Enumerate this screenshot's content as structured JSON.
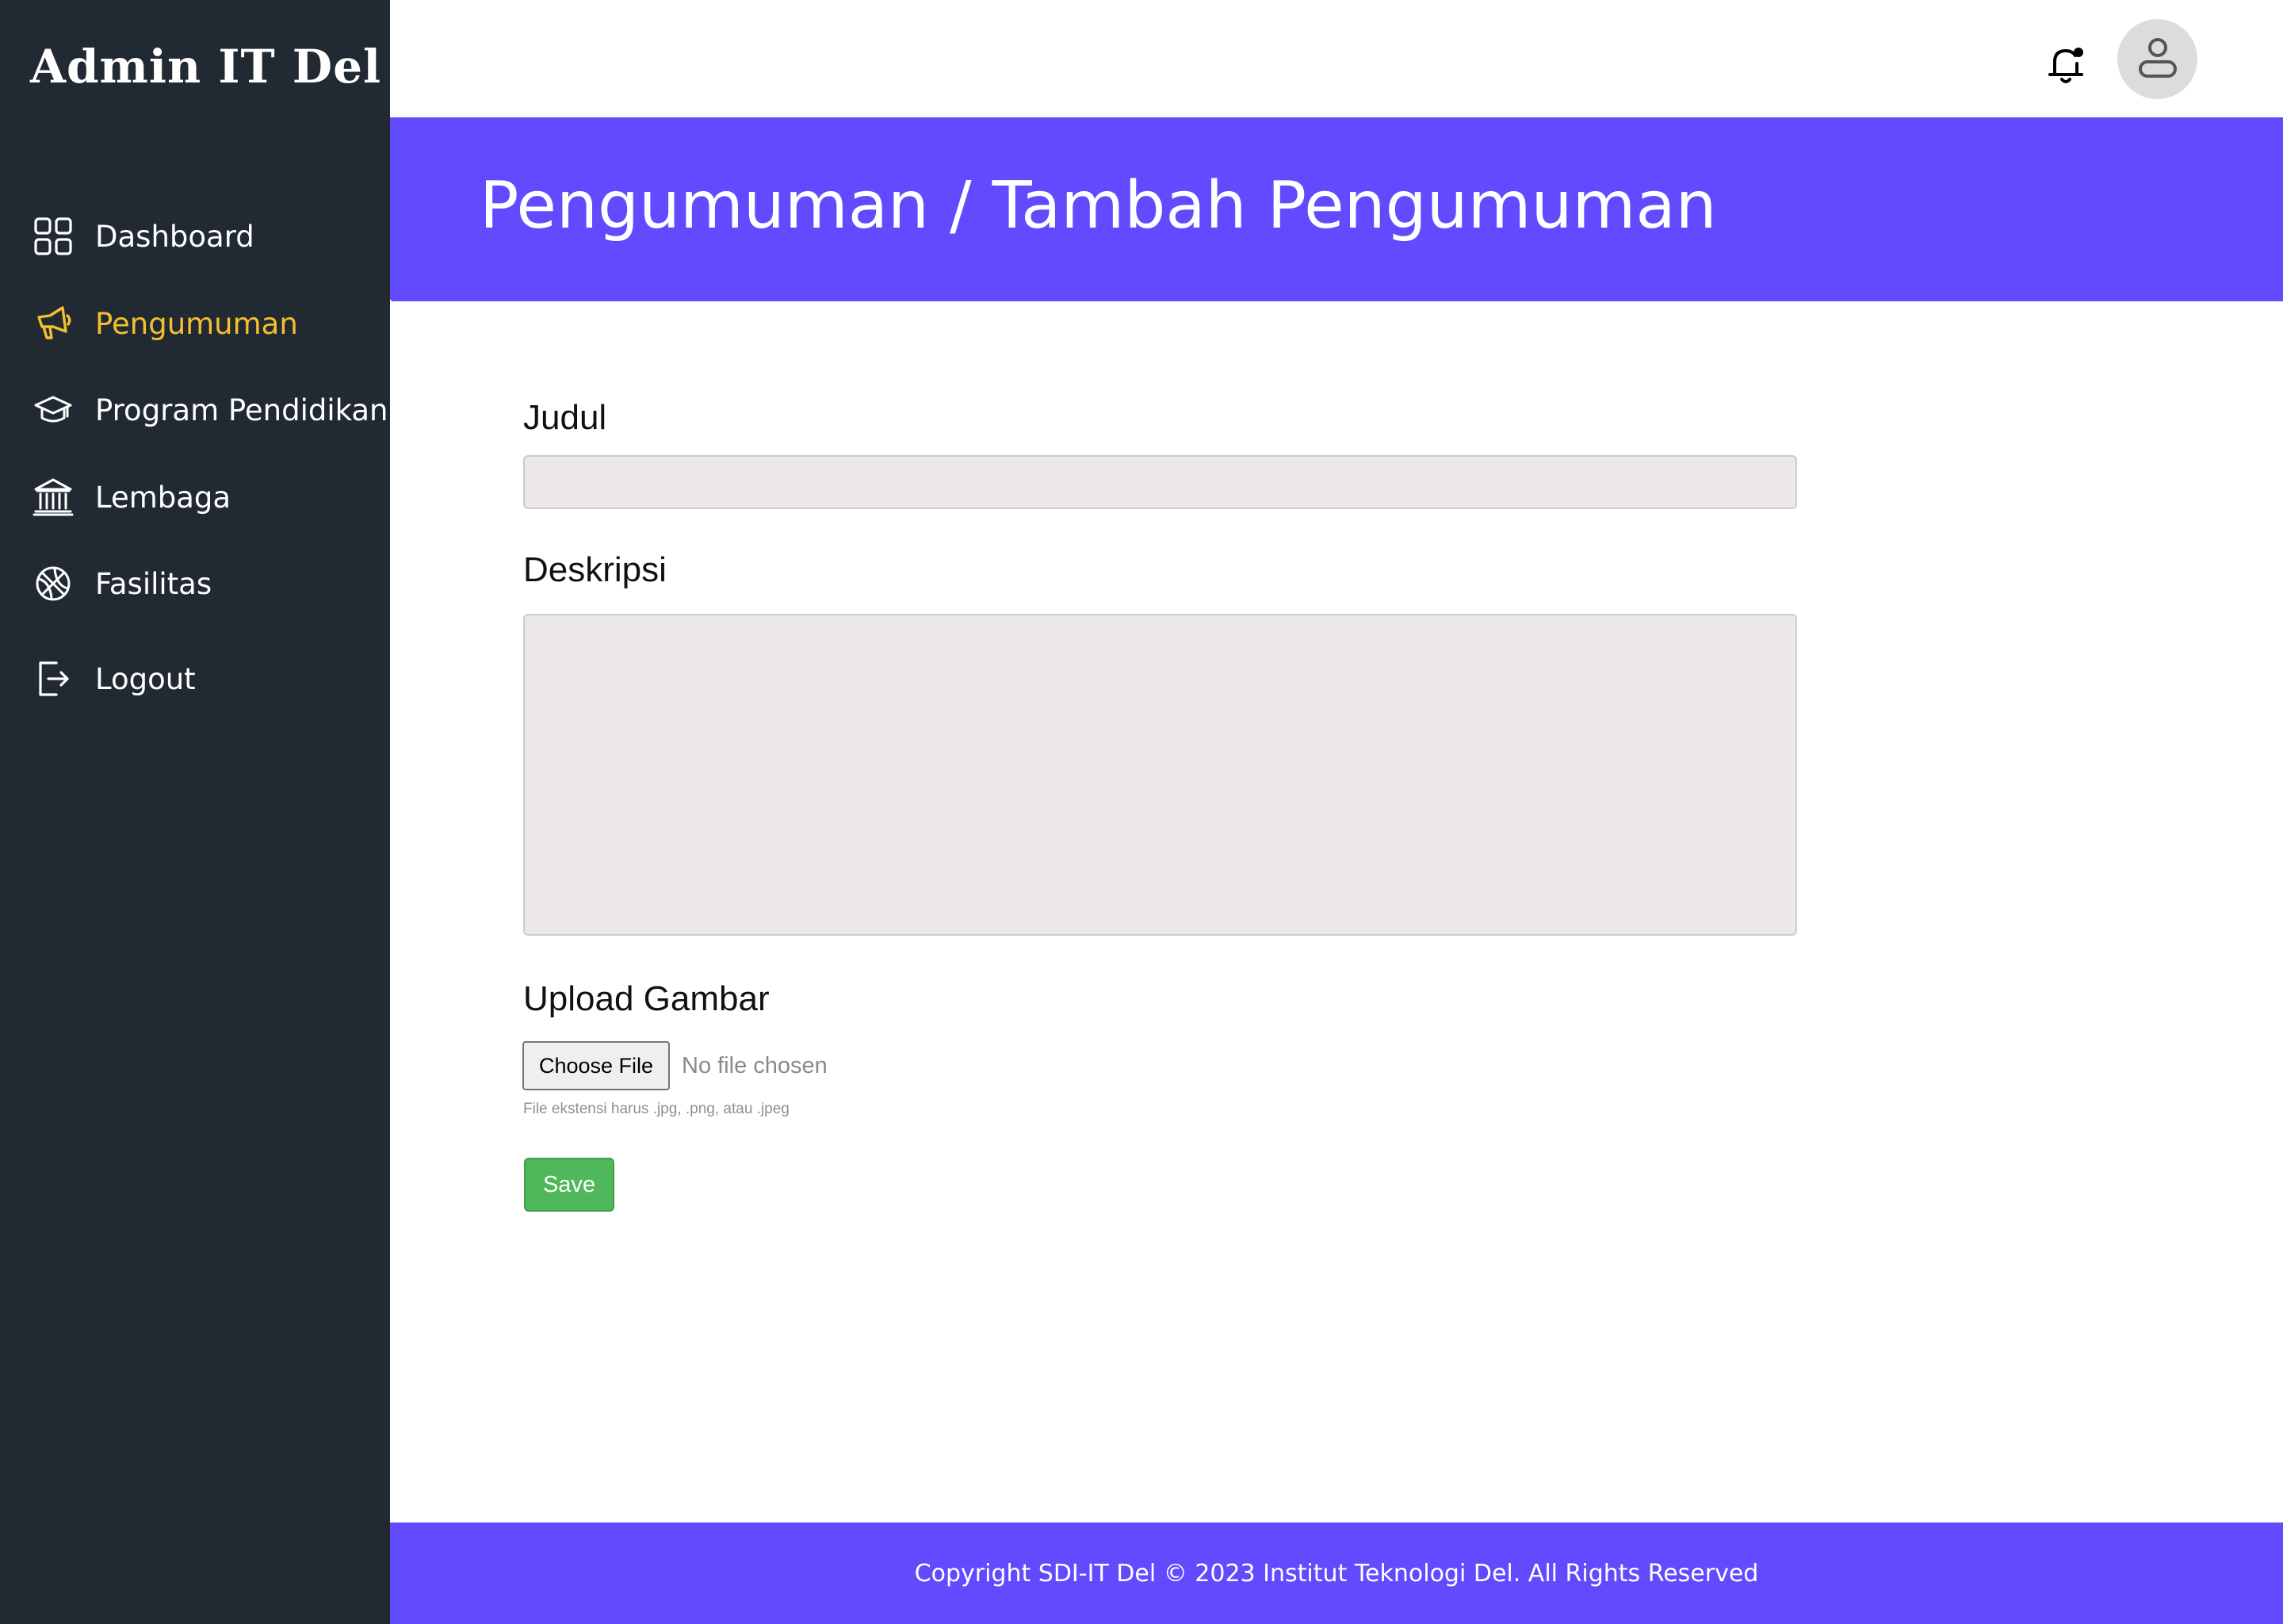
{
  "app": {
    "brand": "Admin IT Del"
  },
  "sidebar": {
    "items": [
      {
        "label": "Dashboard",
        "icon": "grid-icon"
      },
      {
        "label": "Pengumuman",
        "icon": "megaphone-icon",
        "active": true
      },
      {
        "label": "Program Pendidikan",
        "icon": "graduation-cap-icon"
      },
      {
        "label": "Lembaga",
        "icon": "institution-icon"
      },
      {
        "label": "Fasilitas",
        "icon": "basketball-icon"
      },
      {
        "label": "Logout",
        "icon": "logout-icon"
      }
    ]
  },
  "header": {
    "notification_icon": "bell-icon",
    "avatar_icon": "user-icon"
  },
  "banner": {
    "title": "Pengumuman / Tambah Pengumuman"
  },
  "form": {
    "judul_label": "Judul",
    "judul_value": "",
    "deskripsi_label": "Deskripsi",
    "deskripsi_value": "",
    "upload_label": "Upload Gambar",
    "choose_file_label": "Choose File",
    "file_status": "No file chosen",
    "file_hint": "File ekstensi harus .jpg, .png, atau .jpeg",
    "save_label": "Save"
  },
  "footer": {
    "text": "Copyright SDI-IT Del © 2023 Institut Teknologi Del. All Rights Reserved"
  },
  "colors": {
    "sidebar_bg": "#212a33",
    "accent": "#624bff",
    "active_item": "#f3c02c",
    "save_button": "#4fb85a",
    "input_bg": "#ebe8e7"
  }
}
